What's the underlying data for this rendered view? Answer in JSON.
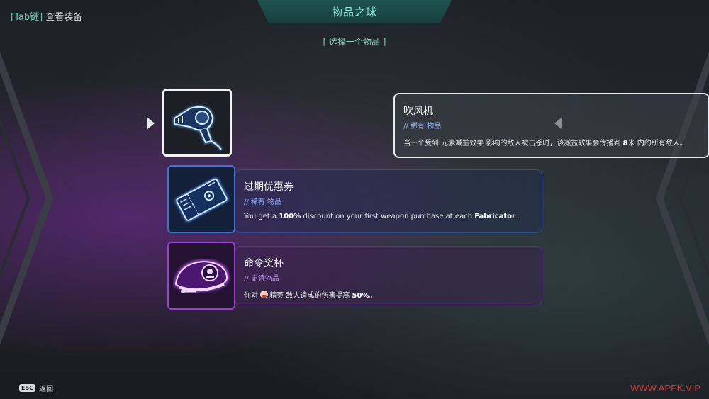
{
  "hud": {
    "tab_key": "[Tab键]",
    "tab_action": "查看装备",
    "title": "物品之球",
    "subtitle": "[ 选择一个物品 ]",
    "esc_key": "ESC",
    "esc_action": "返回",
    "watermark": "WWW.APPK.VIP"
  },
  "items": [
    {
      "name": "吹风机",
      "rarity": "// 稀有 物品",
      "icon": "hair-dryer-icon",
      "desc_parts": [
        "当一个受到 元素减益效果 影响的敌人被击杀时，该减益效果会传播到 ",
        "8",
        "米 内的所有敌人。"
      ],
      "selected": true
    },
    {
      "name": "过期优惠券",
      "rarity": "// 稀有 物品",
      "icon": "coupon-icon",
      "desc_parts": [
        "You get a ",
        "100%",
        " discount on your first weapon purchase at each ",
        "Fabricator",
        "."
      ],
      "selected": false
    },
    {
      "name": "命令奖杯",
      "rarity": "// 史诗物品",
      "icon": "beret-icon",
      "desc_parts": [
        "你对 ",
        "精英 敌人造成的伤害提高 ",
        "50%",
        "。"
      ],
      "selected": false
    }
  ],
  "colors": {
    "rare_accent": "#3d71d6",
    "epic_accent": "#9a3fd6",
    "title_text": "#8be8d4",
    "watermark": "#d33a2f"
  }
}
